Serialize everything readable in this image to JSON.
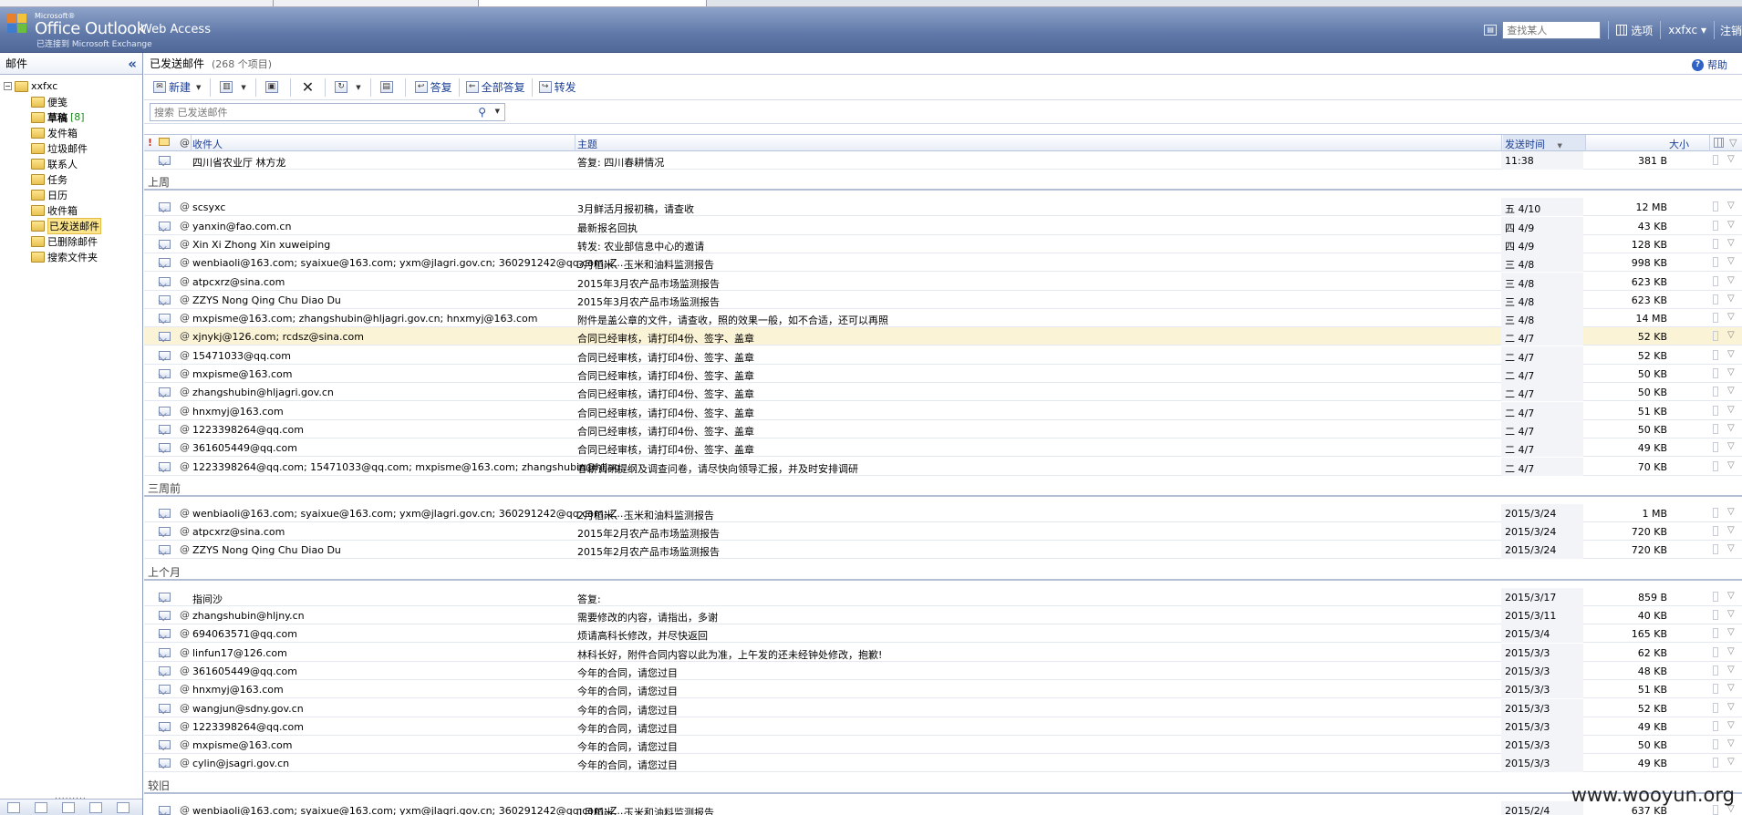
{
  "header": {
    "brand_ms": "Microsoft®",
    "brand_main": "Office Outlook",
    "brand_sub": "Web Access",
    "brand_caption": "已连接到 Microsoft Exchange",
    "search_placeholder": "查找某人",
    "options_label": "选项",
    "user_label": "xxfxc ▾",
    "signout_label": "注销"
  },
  "left_panel": {
    "title": "邮件",
    "root": "xxfxc",
    "folders": [
      {
        "label": "便笺",
        "bold": false,
        "count": ""
      },
      {
        "label": "草稿",
        "bold": true,
        "count": "[8]"
      },
      {
        "label": "发件箱",
        "bold": false,
        "count": ""
      },
      {
        "label": "垃圾邮件",
        "bold": false,
        "count": ""
      },
      {
        "label": "联系人",
        "bold": false,
        "count": ""
      },
      {
        "label": "任务",
        "bold": false,
        "count": ""
      },
      {
        "label": "日历",
        "bold": false,
        "count": ""
      },
      {
        "label": "收件箱",
        "bold": false,
        "count": ""
      },
      {
        "label": "已发送邮件",
        "bold": false,
        "count": "",
        "selected": true
      },
      {
        "label": "已删除邮件",
        "bold": false,
        "count": ""
      },
      {
        "label": "搜索文件夹",
        "bold": false,
        "count": ""
      }
    ]
  },
  "main": {
    "folder_title": "已发送邮件",
    "item_count": "(268 个项目)",
    "help_label": "帮助",
    "toolbar": {
      "new_label": "新建",
      "reply_label": "答复",
      "reply_all_label": "全部答复",
      "forward_label": "转发"
    },
    "search_placeholder": "搜索 已发送邮件",
    "columns": {
      "recipient": "收件人",
      "subject": "主题",
      "sent": "发送时间",
      "size": "大小"
    },
    "groups": [
      {
        "label": "",
        "rows": [
          {
            "to": "四川省农业厅 林方龙",
            "subject": "答复: 四川春耕情况",
            "sent": "11:38",
            "size": "381 B",
            "clip": false
          }
        ]
      },
      {
        "label": "上周",
        "rows": [
          {
            "to": "scsyxc",
            "subject": "3月鲜活月报初稿，请查收",
            "sent": "五 4/10",
            "size": "12 MB",
            "clip": true
          },
          {
            "to": "yanxin@fao.com.cn",
            "subject": "最新报名回执",
            "sent": "四 4/9",
            "size": "43 KB",
            "clip": true
          },
          {
            "to": "Xin Xi Zhong Xin xuweiping",
            "subject": "转发: 农业部信息中心的邀请",
            "sent": "四 4/9",
            "size": "128 KB",
            "clip": true
          },
          {
            "to": "wenbiaoli@163.com; syaixue@163.com; yxm@jlagri.gov.cn; 360291242@qq.com; Z...",
            "subject": "3月稻米、玉米和油料监测报告",
            "sent": "三 4/8",
            "size": "998 KB",
            "clip": true
          },
          {
            "to": "atpcxrz@sina.com",
            "subject": "2015年3月农产品市场监测报告",
            "sent": "三 4/8",
            "size": "623 KB",
            "clip": true
          },
          {
            "to": "ZZYS Nong Qing Chu Diao Du",
            "subject": "2015年3月农产品市场监测报告",
            "sent": "三 4/8",
            "size": "623 KB",
            "clip": true
          },
          {
            "to": "mxpisme@163.com; zhangshubin@hljagri.gov.cn; hnxmyj@163.com",
            "subject": "附件是盖公章的文件，请查收，照的效果一般，如不合适，还可以再照",
            "sent": "三 4/8",
            "size": "14 MB",
            "clip": true
          },
          {
            "to": "xjnykj@126.com; rcdsz@sina.com",
            "subject": "合同已经审核，请打印4份、签字、盖章",
            "sent": "二 4/7",
            "size": "52 KB",
            "clip": true,
            "highlight": true
          },
          {
            "to": "15471033@qq.com",
            "subject": "合同已经审核，请打印4份、签字、盖章",
            "sent": "二 4/7",
            "size": "52 KB",
            "clip": true
          },
          {
            "to": "mxpisme@163.com",
            "subject": "合同已经审核，请打印4份、签字、盖章",
            "sent": "二 4/7",
            "size": "50 KB",
            "clip": true
          },
          {
            "to": "zhangshubin@hljagri.gov.cn",
            "subject": "合同已经审核，请打印4份、签字、盖章",
            "sent": "二 4/7",
            "size": "50 KB",
            "clip": true
          },
          {
            "to": "hnxmyj@163.com",
            "subject": "合同已经审核，请打印4份、签字、盖章",
            "sent": "二 4/7",
            "size": "51 KB",
            "clip": true
          },
          {
            "to": "1223398264@qq.com",
            "subject": "合同已经审核，请打印4份、签字、盖章",
            "sent": "二 4/7",
            "size": "50 KB",
            "clip": true
          },
          {
            "to": "361605449@qq.com",
            "subject": "合同已经审核，请打印4份、签字、盖章",
            "sent": "二 4/7",
            "size": "49 KB",
            "clip": true
          },
          {
            "to": "1223398264@qq.com; 15471033@qq.com; mxpisme@163.com; zhangshubin@hljag...",
            "subject": "春耕调研提纲及调查问卷，请尽快向领导汇报，并及时安排调研",
            "sent": "二 4/7",
            "size": "70 KB",
            "clip": true
          }
        ]
      },
      {
        "label": "三周前",
        "rows": [
          {
            "to": "wenbiaoli@163.com; syaixue@163.com; yxm@jlagri.gov.cn; 360291242@qq.com; Z...",
            "subject": "2月稻米、玉米和油料监测报告",
            "sent": "2015/3/24",
            "size": "1 MB",
            "clip": true
          },
          {
            "to": "atpcxrz@sina.com",
            "subject": "2015年2月农产品市场监测报告",
            "sent": "2015/3/24",
            "size": "720 KB",
            "clip": true
          },
          {
            "to": "ZZYS Nong Qing Chu Diao Du",
            "subject": "2015年2月农产品市场监测报告",
            "sent": "2015/3/24",
            "size": "720 KB",
            "clip": true
          }
        ]
      },
      {
        "label": "上个月",
        "rows": [
          {
            "to": "指间沙",
            "subject": "答复:",
            "sent": "2015/3/17",
            "size": "859 B",
            "clip": false
          },
          {
            "to": "zhangshubin@hljny.cn",
            "subject": "需要修改的内容，请指出，多谢",
            "sent": "2015/3/11",
            "size": "40 KB",
            "clip": true
          },
          {
            "to": "694063571@qq.com",
            "subject": "烦请高科长修改，并尽快返回",
            "sent": "2015/3/4",
            "size": "165 KB",
            "clip": true
          },
          {
            "to": "linfun17@126.com",
            "subject": "林科长好，附件合同内容以此为准，上午发的还未经钟处修改，抱歉!",
            "sent": "2015/3/3",
            "size": "62 KB",
            "clip": true
          },
          {
            "to": "361605449@qq.com",
            "subject": "今年的合同，请您过目",
            "sent": "2015/3/3",
            "size": "48 KB",
            "clip": true
          },
          {
            "to": "hnxmyj@163.com",
            "subject": "今年的合同，请您过目",
            "sent": "2015/3/3",
            "size": "51 KB",
            "clip": true
          },
          {
            "to": "wangjun@sdny.gov.cn",
            "subject": "今年的合同，请您过目",
            "sent": "2015/3/3",
            "size": "52 KB",
            "clip": true
          },
          {
            "to": "1223398264@qq.com",
            "subject": "今年的合同，请您过目",
            "sent": "2015/3/3",
            "size": "49 KB",
            "clip": true
          },
          {
            "to": "mxpisme@163.com",
            "subject": "今年的合同，请您过目",
            "sent": "2015/3/3",
            "size": "50 KB",
            "clip": true
          },
          {
            "to": "cylin@jsagri.gov.cn",
            "subject": "今年的合同，请您过目",
            "sent": "2015/3/3",
            "size": "49 KB",
            "clip": true
          }
        ]
      },
      {
        "label": "较旧",
        "rows": [
          {
            "to": "wenbiaoli@163.com; syaixue@163.com; yxm@jlagri.gov.cn; 360291242@qq.com; Z...",
            "subject": "1月稻米、玉米和油料监测报告",
            "sent": "2015/2/4",
            "size": "637 KB",
            "clip": true
          }
        ]
      }
    ]
  },
  "watermark": "www.wooyun.org"
}
